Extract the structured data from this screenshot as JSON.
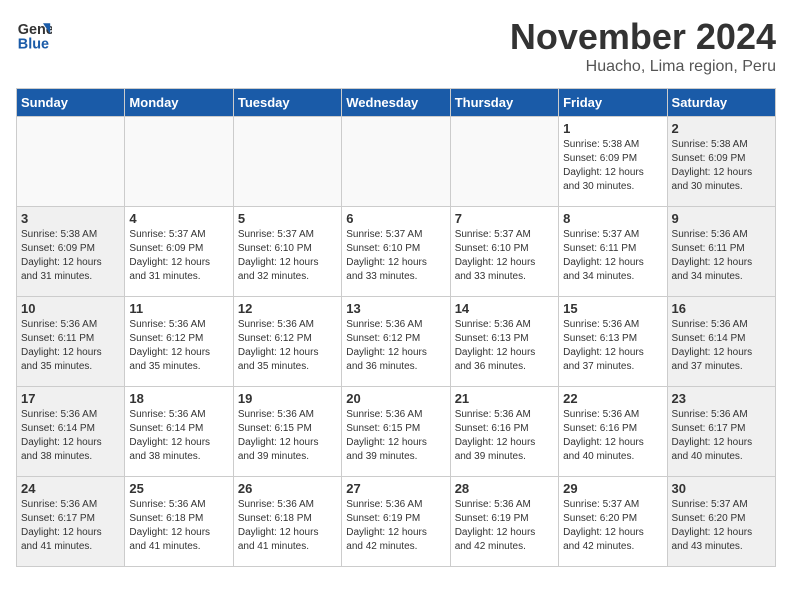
{
  "logo": {
    "line1": "General",
    "line2": "Blue"
  },
  "title": "November 2024",
  "subtitle": "Huacho, Lima region, Peru",
  "weekdays": [
    "Sunday",
    "Monday",
    "Tuesday",
    "Wednesday",
    "Thursday",
    "Friday",
    "Saturday"
  ],
  "weeks": [
    [
      {
        "day": "",
        "info": ""
      },
      {
        "day": "",
        "info": ""
      },
      {
        "day": "",
        "info": ""
      },
      {
        "day": "",
        "info": ""
      },
      {
        "day": "",
        "info": ""
      },
      {
        "day": "1",
        "info": "Sunrise: 5:38 AM\nSunset: 6:09 PM\nDaylight: 12 hours\nand 30 minutes."
      },
      {
        "day": "2",
        "info": "Sunrise: 5:38 AM\nSunset: 6:09 PM\nDaylight: 12 hours\nand 30 minutes."
      }
    ],
    [
      {
        "day": "3",
        "info": "Sunrise: 5:38 AM\nSunset: 6:09 PM\nDaylight: 12 hours\nand 31 minutes."
      },
      {
        "day": "4",
        "info": "Sunrise: 5:37 AM\nSunset: 6:09 PM\nDaylight: 12 hours\nand 31 minutes."
      },
      {
        "day": "5",
        "info": "Sunrise: 5:37 AM\nSunset: 6:10 PM\nDaylight: 12 hours\nand 32 minutes."
      },
      {
        "day": "6",
        "info": "Sunrise: 5:37 AM\nSunset: 6:10 PM\nDaylight: 12 hours\nand 33 minutes."
      },
      {
        "day": "7",
        "info": "Sunrise: 5:37 AM\nSunset: 6:10 PM\nDaylight: 12 hours\nand 33 minutes."
      },
      {
        "day": "8",
        "info": "Sunrise: 5:37 AM\nSunset: 6:11 PM\nDaylight: 12 hours\nand 34 minutes."
      },
      {
        "day": "9",
        "info": "Sunrise: 5:36 AM\nSunset: 6:11 PM\nDaylight: 12 hours\nand 34 minutes."
      }
    ],
    [
      {
        "day": "10",
        "info": "Sunrise: 5:36 AM\nSunset: 6:11 PM\nDaylight: 12 hours\nand 35 minutes."
      },
      {
        "day": "11",
        "info": "Sunrise: 5:36 AM\nSunset: 6:12 PM\nDaylight: 12 hours\nand 35 minutes."
      },
      {
        "day": "12",
        "info": "Sunrise: 5:36 AM\nSunset: 6:12 PM\nDaylight: 12 hours\nand 35 minutes."
      },
      {
        "day": "13",
        "info": "Sunrise: 5:36 AM\nSunset: 6:12 PM\nDaylight: 12 hours\nand 36 minutes."
      },
      {
        "day": "14",
        "info": "Sunrise: 5:36 AM\nSunset: 6:13 PM\nDaylight: 12 hours\nand 36 minutes."
      },
      {
        "day": "15",
        "info": "Sunrise: 5:36 AM\nSunset: 6:13 PM\nDaylight: 12 hours\nand 37 minutes."
      },
      {
        "day": "16",
        "info": "Sunrise: 5:36 AM\nSunset: 6:14 PM\nDaylight: 12 hours\nand 37 minutes."
      }
    ],
    [
      {
        "day": "17",
        "info": "Sunrise: 5:36 AM\nSunset: 6:14 PM\nDaylight: 12 hours\nand 38 minutes."
      },
      {
        "day": "18",
        "info": "Sunrise: 5:36 AM\nSunset: 6:14 PM\nDaylight: 12 hours\nand 38 minutes."
      },
      {
        "day": "19",
        "info": "Sunrise: 5:36 AM\nSunset: 6:15 PM\nDaylight: 12 hours\nand 39 minutes."
      },
      {
        "day": "20",
        "info": "Sunrise: 5:36 AM\nSunset: 6:15 PM\nDaylight: 12 hours\nand 39 minutes."
      },
      {
        "day": "21",
        "info": "Sunrise: 5:36 AM\nSunset: 6:16 PM\nDaylight: 12 hours\nand 39 minutes."
      },
      {
        "day": "22",
        "info": "Sunrise: 5:36 AM\nSunset: 6:16 PM\nDaylight: 12 hours\nand 40 minutes."
      },
      {
        "day": "23",
        "info": "Sunrise: 5:36 AM\nSunset: 6:17 PM\nDaylight: 12 hours\nand 40 minutes."
      }
    ],
    [
      {
        "day": "24",
        "info": "Sunrise: 5:36 AM\nSunset: 6:17 PM\nDaylight: 12 hours\nand 41 minutes."
      },
      {
        "day": "25",
        "info": "Sunrise: 5:36 AM\nSunset: 6:18 PM\nDaylight: 12 hours\nand 41 minutes."
      },
      {
        "day": "26",
        "info": "Sunrise: 5:36 AM\nSunset: 6:18 PM\nDaylight: 12 hours\nand 41 minutes."
      },
      {
        "day": "27",
        "info": "Sunrise: 5:36 AM\nSunset: 6:19 PM\nDaylight: 12 hours\nand 42 minutes."
      },
      {
        "day": "28",
        "info": "Sunrise: 5:36 AM\nSunset: 6:19 PM\nDaylight: 12 hours\nand 42 minutes."
      },
      {
        "day": "29",
        "info": "Sunrise: 5:37 AM\nSunset: 6:20 PM\nDaylight: 12 hours\nand 42 minutes."
      },
      {
        "day": "30",
        "info": "Sunrise: 5:37 AM\nSunset: 6:20 PM\nDaylight: 12 hours\nand 43 minutes."
      }
    ]
  ]
}
